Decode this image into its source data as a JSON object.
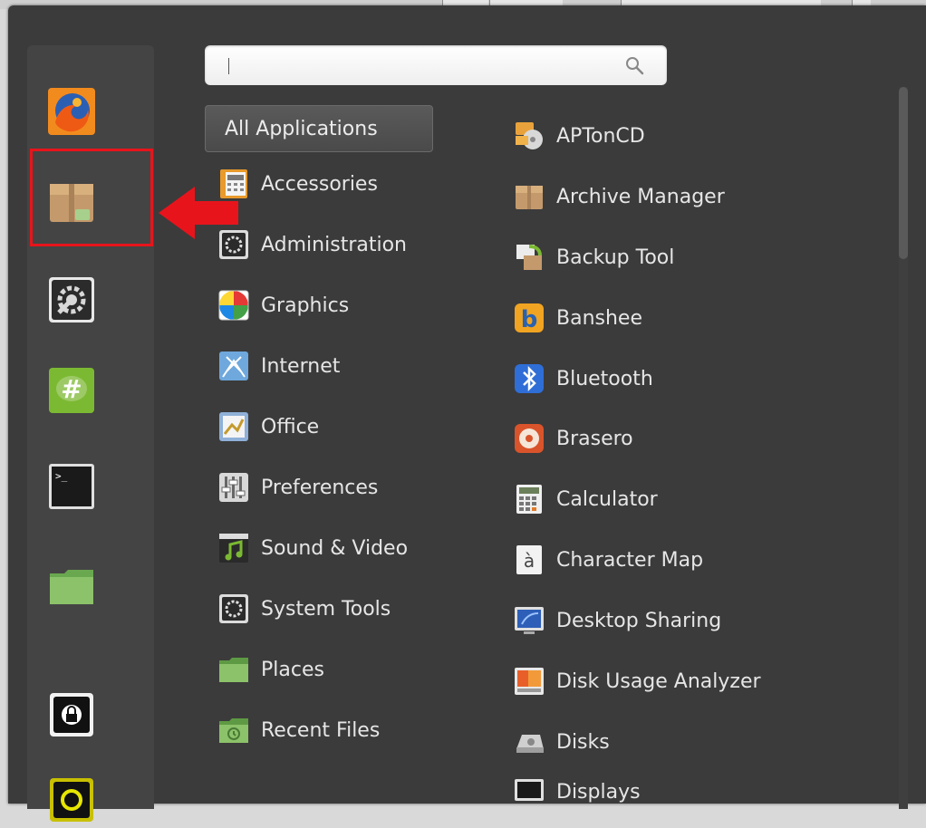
{
  "search": {
    "placeholder": "",
    "value": ""
  },
  "favorites": [
    {
      "name": "firefox",
      "icon": "firefox-icon"
    },
    {
      "name": "archive-manager",
      "icon": "archive-box-icon"
    },
    {
      "name": "system-settings",
      "icon": "settings-gear-icon"
    },
    {
      "name": "chat",
      "icon": "chat-hash-icon"
    },
    {
      "name": "terminal",
      "icon": "terminal-icon"
    },
    {
      "name": "files",
      "icon": "folder-icon"
    },
    {
      "name": "lock-screen",
      "icon": "lock-icon"
    },
    {
      "name": "logout",
      "icon": "power-icon"
    }
  ],
  "categories": {
    "selected": "All Applications",
    "items": [
      "Accessories",
      "Administration",
      "Graphics",
      "Internet",
      "Office",
      "Preferences",
      "Sound & Video",
      "System Tools",
      "Places",
      "Recent Files"
    ]
  },
  "apps": [
    "APTonCD",
    "Archive Manager",
    "Backup Tool",
    "Banshee",
    "Bluetooth",
    "Brasero",
    "Calculator",
    "Character Map",
    "Desktop Sharing",
    "Disk Usage Analyzer",
    "Disks",
    "Displays"
  ],
  "colors": {
    "highlight": "#e8141c",
    "menu_bg": "#3b3b3b",
    "favbar_bg": "#444444"
  }
}
